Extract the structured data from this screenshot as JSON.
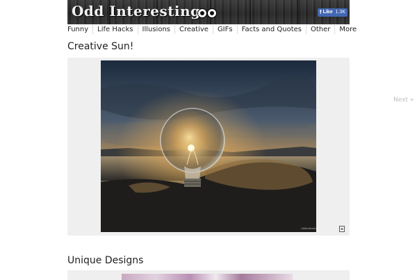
{
  "site": {
    "logo_text": "Odd Interesting",
    "fb_like_label": "Like",
    "fb_like_count": "1.3K"
  },
  "nav": {
    "items": [
      "Funny",
      "Life Hacks",
      "Illusions",
      "Creative",
      "GIFs",
      "Facts and Quotes",
      "Other",
      "More"
    ]
  },
  "posts": [
    {
      "title": "Creative Sun!"
    },
    {
      "title": "Unique Designs"
    }
  ],
  "pager": {
    "next_label": "Next »"
  },
  "colors": {
    "fb_blue": "#4267b2",
    "image_bg": "#efefef",
    "next_text": "#bdbdbd"
  }
}
